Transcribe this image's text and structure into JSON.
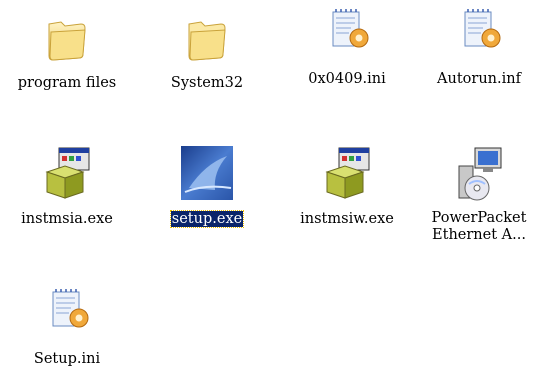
{
  "desktop": {
    "items": [
      {
        "label": "program files"
      },
      {
        "label": "System32"
      },
      {
        "label": "0x0409.ini"
      },
      {
        "label": "Autorun.inf"
      },
      {
        "label": "instmsia.exe"
      },
      {
        "label": "setup.exe"
      },
      {
        "label": "instmsiw.exe"
      },
      {
        "label1": "PowerPacket",
        "label2": "Ethernet A..."
      },
      {
        "label": "Setup.ini"
      }
    ]
  },
  "colors": {
    "selection_bg": "#0a246a",
    "selection_text": "#ffffff",
    "folder_yellow": "#f6dc78"
  }
}
